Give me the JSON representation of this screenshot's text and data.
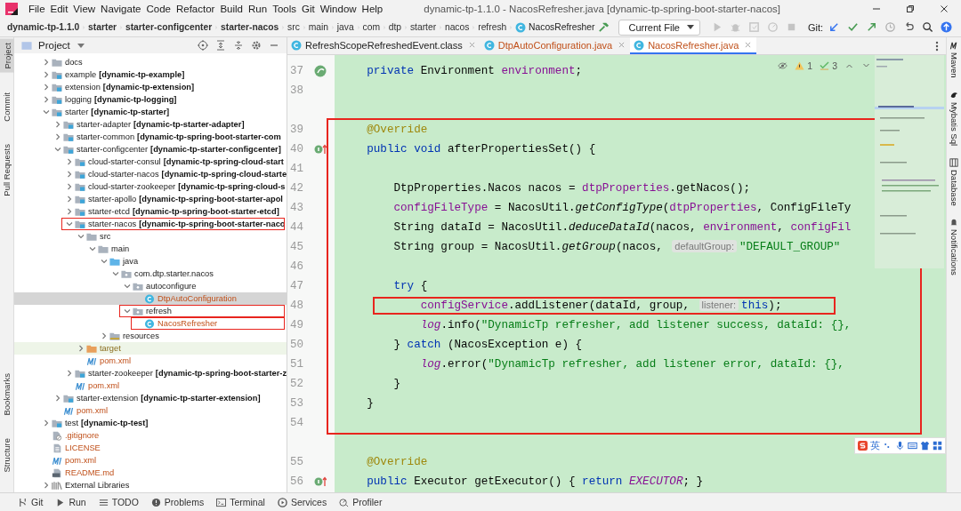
{
  "window": {
    "title": "dynamic-tp-1.1.0 - NacosRefresher.java [dynamic-tp-spring-boot-starter-nacos]"
  },
  "menu": [
    "File",
    "Edit",
    "View",
    "Navigate",
    "Code",
    "Refactor",
    "Build",
    "Run",
    "Tools",
    "Git",
    "Window",
    "Help"
  ],
  "breadcrumb": [
    {
      "label": "dynamic-tp-1.1.0",
      "bold": true
    },
    {
      "label": "starter",
      "bold": true
    },
    {
      "label": "starter-configcenter",
      "bold": true
    },
    {
      "label": "starter-nacos",
      "bold": true
    },
    {
      "label": "src",
      "bold": false
    },
    {
      "label": "main",
      "bold": false
    },
    {
      "label": "java",
      "bold": false
    },
    {
      "label": "com",
      "bold": false
    },
    {
      "label": "dtp",
      "bold": false
    },
    {
      "label": "starter",
      "bold": false
    },
    {
      "label": "nacos",
      "bold": false
    },
    {
      "label": "refresh",
      "bold": false
    },
    {
      "label": "NacosRefresher",
      "bold": false,
      "kind": "class"
    }
  ],
  "run_config": "Current File",
  "git_label": "Git:",
  "left_stripe_top": [
    {
      "label": "Project",
      "selected": true
    },
    {
      "label": "Commit",
      "selected": false
    },
    {
      "label": "Pull Requests",
      "selected": false
    }
  ],
  "left_stripe_bottom": [
    {
      "label": "Bookmarks",
      "selected": false
    },
    {
      "label": "Structure",
      "selected": false
    }
  ],
  "right_stripe": [
    {
      "label": "Maven",
      "kind": "maven"
    },
    {
      "label": "Mybatis Sql",
      "kind": "bird"
    },
    {
      "label": "Database",
      "kind": "database"
    },
    {
      "label": "Notifications",
      "kind": "bell"
    }
  ],
  "project": {
    "title": "Project",
    "tree": [
      {
        "name": "docs",
        "kind": "folder",
        "expanded": false
      },
      {
        "name": "example",
        "module": "[dynamic-tp-example]",
        "kind": "module",
        "expanded": false
      },
      {
        "name": "extension",
        "module": "[dynamic-tp-extension]",
        "kind": "module",
        "expanded": false
      },
      {
        "name": "logging",
        "module": "[dynamic-tp-logging]",
        "kind": "module",
        "expanded": false
      },
      {
        "name": "starter",
        "module": "[dynamic-tp-starter]",
        "kind": "module",
        "expanded": true,
        "children": [
          {
            "name": "starter-adapter",
            "module": "[dynamic-tp-starter-adapter]",
            "kind": "module",
            "expanded": false
          },
          {
            "name": "starter-common",
            "module": "[dynamic-tp-spring-boot-starter-com",
            "kind": "module",
            "expanded": false
          },
          {
            "name": "starter-configcenter",
            "module": "[dynamic-tp-starter-configcenter]",
            "kind": "module",
            "expanded": true,
            "children": [
              {
                "name": "cloud-starter-consul",
                "module": "[dynamic-tp-spring-cloud-start",
                "kind": "module",
                "expanded": false
              },
              {
                "name": "cloud-starter-nacos",
                "module": "[dynamic-tp-spring-cloud-starte",
                "kind": "module",
                "expanded": false
              },
              {
                "name": "cloud-starter-zookeeper",
                "module": "[dynamic-tp-spring-cloud-s",
                "kind": "module",
                "expanded": false
              },
              {
                "name": "starter-apollo",
                "module": "[dynamic-tp-spring-boot-starter-apol",
                "kind": "module",
                "expanded": false
              },
              {
                "name": "starter-etcd",
                "module": "[dynamic-tp-spring-boot-starter-etcd]",
                "kind": "module",
                "expanded": false
              },
              {
                "name": "starter-nacos",
                "module": "[dynamic-tp-spring-boot-starter-naco",
                "kind": "module",
                "expanded": true,
                "boxed": true,
                "children": [
                  {
                    "name": "src",
                    "kind": "folder",
                    "expanded": true,
                    "children": [
                      {
                        "name": "main",
                        "kind": "folder",
                        "expanded": true,
                        "children": [
                          {
                            "name": "java",
                            "kind": "source",
                            "expanded": true,
                            "children": [
                              {
                                "name": "com.dtp.starter.nacos",
                                "kind": "package",
                                "expanded": true,
                                "children": [
                                  {
                                    "name": "autoconfigure",
                                    "kind": "package",
                                    "expanded": true,
                                    "children": [
                                      {
                                        "name": "DtpAutoConfiguration",
                                        "kind": "class",
                                        "unversioned": true,
                                        "selected": true
                                      }
                                    ]
                                  },
                                  {
                                    "name": "refresh",
                                    "kind": "package",
                                    "expanded": true,
                                    "boxed": true,
                                    "children": [
                                      {
                                        "name": "NacosRefresher",
                                        "kind": "class",
                                        "unversioned": true,
                                        "selected": false,
                                        "boxed": true
                                      }
                                    ]
                                  }
                                ]
                              }
                            ]
                          },
                          {
                            "name": "resources",
                            "kind": "resources",
                            "expanded": false
                          }
                        ]
                      }
                    ]
                  },
                  {
                    "name": "target",
                    "kind": "target",
                    "expanded": false,
                    "ignored": true
                  },
                  {
                    "name": "pom.xml",
                    "kind": "maven",
                    "unversioned": true
                  }
                ]
              },
              {
                "name": "starter-zookeeper",
                "module": "[dynamic-tp-spring-boot-starter-z",
                "kind": "module",
                "expanded": false
              },
              {
                "name": "pom.xml",
                "kind": "maven",
                "unversioned": true
              }
            ]
          },
          {
            "name": "starter-extension",
            "module": "[dynamic-tp-starter-extension]",
            "kind": "module",
            "expanded": false
          },
          {
            "name": "pom.xml",
            "kind": "maven",
            "unversioned": true
          }
        ]
      },
      {
        "name": "test",
        "module": "[dynamic-tp-test]",
        "kind": "module",
        "expanded": false
      },
      {
        "name": ".gitignore",
        "kind": "git",
        "unversioned": true
      },
      {
        "name": "LICENSE",
        "kind": "file",
        "unversioned": true
      },
      {
        "name": "pom.xml",
        "kind": "maven",
        "unversioned": true
      },
      {
        "name": "README.md",
        "kind": "markdown",
        "unversioned": true
      },
      {
        "name": "External Libraries",
        "kind": "libraries",
        "expanded": false
      }
    ]
  },
  "tabs": [
    {
      "label": "RefreshScopeRefreshedEvent.class",
      "selected": false,
      "unversioned": false
    },
    {
      "label": "DtpAutoConfiguration.java",
      "selected": false,
      "unversioned": true
    },
    {
      "label": "NacosRefresher.java",
      "selected": true,
      "unversioned": true
    }
  ],
  "inspections": {
    "warnings": "1",
    "weak_warnings": "3"
  },
  "code_blocks": [
    {
      "boxed": false,
      "lines": [
        {
          "number": "37",
          "kind": "bean",
          "tokens": [
            {
              "kind": "kw",
              "text": "    private"
            },
            {
              "kind": "plain",
              "text": " Environment "
            },
            {
              "kind": "field",
              "text": "environment"
            },
            {
              "kind": "plain",
              "text": ";"
            }
          ]
        },
        {
          "number": "38",
          "kind": "plain"
        }
      ]
    },
    {
      "boxed": true,
      "lines": [
        {
          "number": "39",
          "kind": "plain",
          "tokens": [
            {
              "kind": "ann",
              "text": "    @Override"
            }
          ]
        },
        {
          "number": "40",
          "kind": "implements",
          "tokens": [
            {
              "kind": "kw",
              "text": "    public void"
            },
            {
              "kind": "plain",
              "text": " afterPropertiesSet() {"
            }
          ]
        },
        {
          "number": "41",
          "kind": "plain"
        },
        {
          "number": "42",
          "kind": "plain",
          "tokens": [
            {
              "kind": "plain",
              "text": "        DtpProperties.Nacos nacos = "
            },
            {
              "kind": "field",
              "text": "dtpProperties"
            },
            {
              "kind": "plain",
              "text": ".getNacos();"
            }
          ]
        },
        {
          "number": "43",
          "kind": "plain",
          "tokens": [
            {
              "kind": "field",
              "text": "        configFileType"
            },
            {
              "kind": "plain",
              "text": " = NacosUtil."
            },
            {
              "kind": "call",
              "text": "getConfigType"
            },
            {
              "kind": "plain",
              "text": "("
            },
            {
              "kind": "field",
              "text": "dtpProperties"
            },
            {
              "kind": "plain",
              "text": ", ConfigFileTy"
            }
          ]
        },
        {
          "number": "44",
          "kind": "plain",
          "tokens": [
            {
              "kind": "plain",
              "text": "        String dataId = NacosUtil."
            },
            {
              "kind": "call",
              "text": "deduceDataId"
            },
            {
              "kind": "plain",
              "text": "(nacos, "
            },
            {
              "kind": "field",
              "text": "environment"
            },
            {
              "kind": "plain",
              "text": ", "
            },
            {
              "kind": "field",
              "text": "configFil"
            }
          ]
        },
        {
          "number": "45",
          "kind": "plain",
          "tokens": [
            {
              "kind": "plain",
              "text": "        String group = NacosUtil."
            },
            {
              "kind": "call",
              "text": "getGroup"
            },
            {
              "kind": "plain",
              "text": "(nacos, "
            },
            {
              "kind": "hint",
              "text": "defaultGroup:"
            },
            {
              "kind": "str",
              "text": "\"DEFAULT_GROUP\""
            }
          ]
        },
        {
          "number": "46",
          "kind": "plain"
        },
        {
          "number": "47",
          "kind": "plain",
          "tokens": [
            {
              "kind": "kw",
              "text": "        try"
            },
            {
              "kind": "plain",
              "text": " {"
            }
          ]
        },
        {
          "number": "48",
          "kind": "plain",
          "marked": true,
          "tokens": [
            {
              "kind": "field",
              "text": "            configService"
            },
            {
              "kind": "plain",
              "text": ".addListener(dataId, group, "
            },
            {
              "kind": "hint",
              "text": "listener:"
            },
            {
              "kind": "kw",
              "text": "this"
            },
            {
              "kind": "plain",
              "text": ");"
            }
          ]
        },
        {
          "number": "49",
          "kind": "plain",
          "tokens": [
            {
              "kind": "static",
              "text": "            log"
            },
            {
              "kind": "plain",
              "text": ".info("
            },
            {
              "kind": "str",
              "text": "\"DynamicTp refresher, add listener success, dataId: {},"
            }
          ]
        },
        {
          "number": "50",
          "kind": "plain",
          "tokens": [
            {
              "kind": "plain",
              "text": "        } "
            },
            {
              "kind": "kw",
              "text": "catch"
            },
            {
              "kind": "plain",
              "text": " (NacosException e) {"
            }
          ]
        },
        {
          "number": "51",
          "kind": "plain",
          "tokens": [
            {
              "kind": "static",
              "text": "            log"
            },
            {
              "kind": "plain",
              "text": ".error("
            },
            {
              "kind": "str",
              "text": "\"DynamicTp refresher, add listener error, dataId: {},"
            }
          ]
        },
        {
          "number": "52",
          "kind": "plain",
          "tokens": [
            {
              "kind": "plain",
              "text": "        }"
            }
          ]
        },
        {
          "number": "53",
          "kind": "plain",
          "tokens": [
            {
              "kind": "plain",
              "text": "    }"
            }
          ]
        },
        {
          "number": "54",
          "kind": "plain"
        }
      ]
    },
    {
      "boxed": false,
      "lines": [
        {
          "number": "55",
          "kind": "plain",
          "tokens": [
            {
              "kind": "ann",
              "text": "    @Override"
            }
          ]
        },
        {
          "number": "56",
          "kind": "implements",
          "tokens": [
            {
              "kind": "kw",
              "text": "    public"
            },
            {
              "kind": "plain",
              "text": " Executor getExecutor() { "
            },
            {
              "kind": "kw",
              "text": "return"
            },
            {
              "kind": "static",
              "text": " EXECUTOR"
            },
            {
              "kind": "plain",
              "text": "; }"
            }
          ]
        }
      ]
    }
  ],
  "ime_bar": {
    "label": "英"
  },
  "bottom_tools": [
    {
      "label": "Git",
      "kind": "git"
    },
    {
      "label": "Run",
      "kind": "run"
    },
    {
      "label": "TODO",
      "kind": "list"
    },
    {
      "label": "Problems",
      "kind": "problems"
    },
    {
      "label": "Terminal",
      "kind": "terminal"
    },
    {
      "label": "Services",
      "kind": "services"
    },
    {
      "label": "Profiler",
      "kind": "profiler"
    }
  ]
}
